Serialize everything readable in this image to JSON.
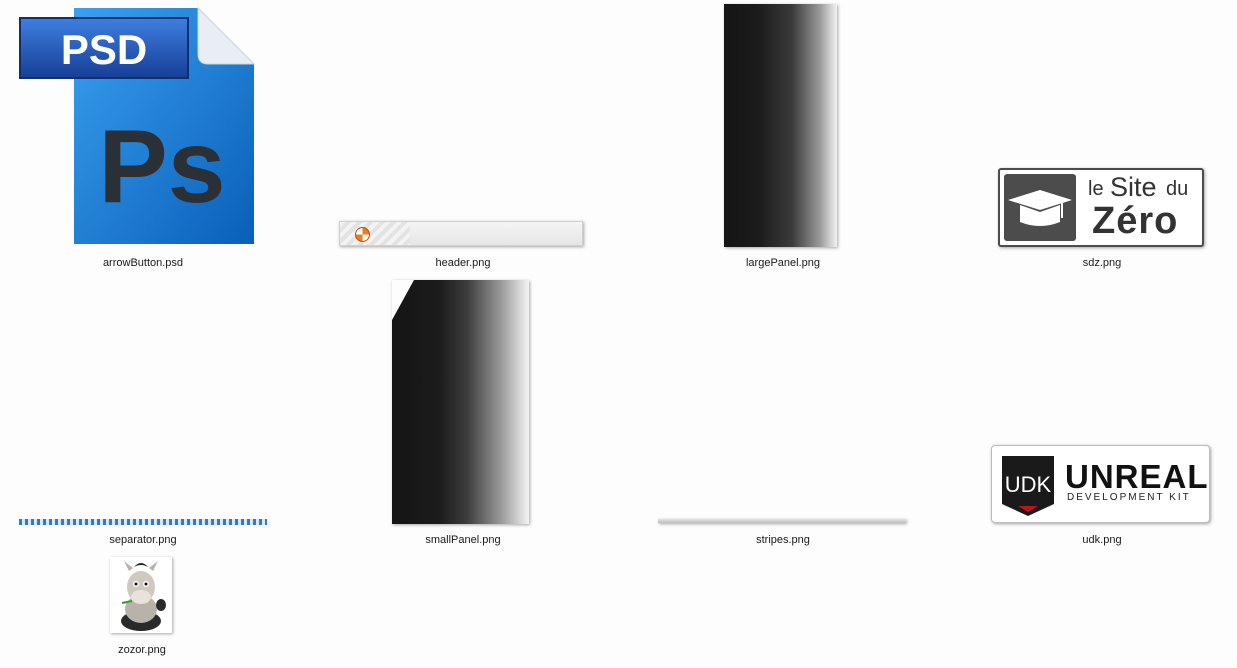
{
  "files": [
    {
      "name": "arrowButton.psd",
      "icon": "photoshop-psd-file-icon",
      "badge": "PSD",
      "mark": "Ps"
    },
    {
      "name": "header.png",
      "icon": "header-thumbnail"
    },
    {
      "name": "largePanel.png",
      "icon": "large-panel-thumbnail"
    },
    {
      "name": "sdz.png",
      "icon": "site-du-zero-logo-thumbnail",
      "logo_text": [
        "le",
        "Site",
        "du",
        "Zéro"
      ]
    },
    {
      "name": "separator.png",
      "icon": "separator-thumbnail"
    },
    {
      "name": "smallPanel.png",
      "icon": "small-panel-thumbnail"
    },
    {
      "name": "stripes.png",
      "icon": "stripes-thumbnail"
    },
    {
      "name": "udk.png",
      "icon": "unreal-development-kit-logo-thumbnail",
      "logo_text": [
        "UDK",
        "UNREAL",
        "DEVELOPMENT KIT"
      ]
    },
    {
      "name": "zozor.png",
      "icon": "zozor-mascot-thumbnail"
    }
  ],
  "colors": {
    "background": "#fdfdfd",
    "psd_blue": "#1a7fd6",
    "psd_badge": "#1e4fae",
    "header_orb": "#f07a1c",
    "separator_blue": "#2a7ad6",
    "logo_gray": "#4c4c4c"
  }
}
